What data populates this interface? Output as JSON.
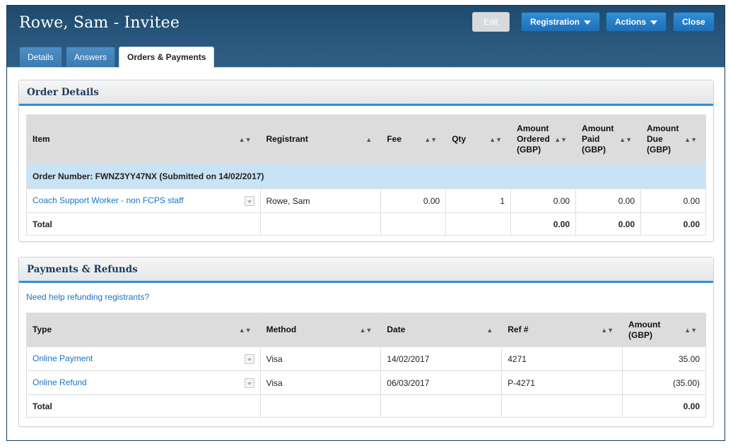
{
  "header": {
    "title": "Rowe, Sam - Invitee",
    "edit_label": "Edit",
    "registration_label": "Registration",
    "actions_label": "Actions",
    "close_label": "Close"
  },
  "tabs": [
    {
      "label": "Details"
    },
    {
      "label": "Answers"
    },
    {
      "label": "Orders & Payments"
    }
  ],
  "order_details": {
    "title": "Order Details",
    "columns": [
      "Item",
      "Registrant",
      "Fee",
      "Qty",
      "Amount Ordered (GBP)",
      "Amount Paid (GBP)",
      "Amount Due (GBP)"
    ],
    "order_number": "Order Number: FWNZ3YY47NX (Submitted on 14/02/2017)",
    "row": {
      "item": "Coach Support Worker - non FCPS staff",
      "registrant": "Rowe, Sam",
      "fee": "0.00",
      "qty": "1",
      "ordered": "0.00",
      "paid": "0.00",
      "due": "0.00"
    },
    "total": {
      "label": "Total",
      "ordered": "0.00",
      "paid": "0.00",
      "due": "0.00"
    }
  },
  "payments": {
    "title": "Payments & Refunds",
    "help_link": "Need help refunding registrants?",
    "columns": [
      "Type",
      "Method",
      "Date",
      "Ref #",
      "Amount (GBP)"
    ],
    "rows": [
      {
        "type": "Online Payment",
        "method": "Visa",
        "date": "14/02/2017",
        "ref": "4271",
        "amount": "35.00"
      },
      {
        "type": "Online Refund",
        "method": "Visa",
        "date": "06/03/2017",
        "ref": "P-4271",
        "amount": "(35.00)"
      }
    ],
    "total": {
      "label": "Total",
      "amount": "0.00"
    }
  }
}
